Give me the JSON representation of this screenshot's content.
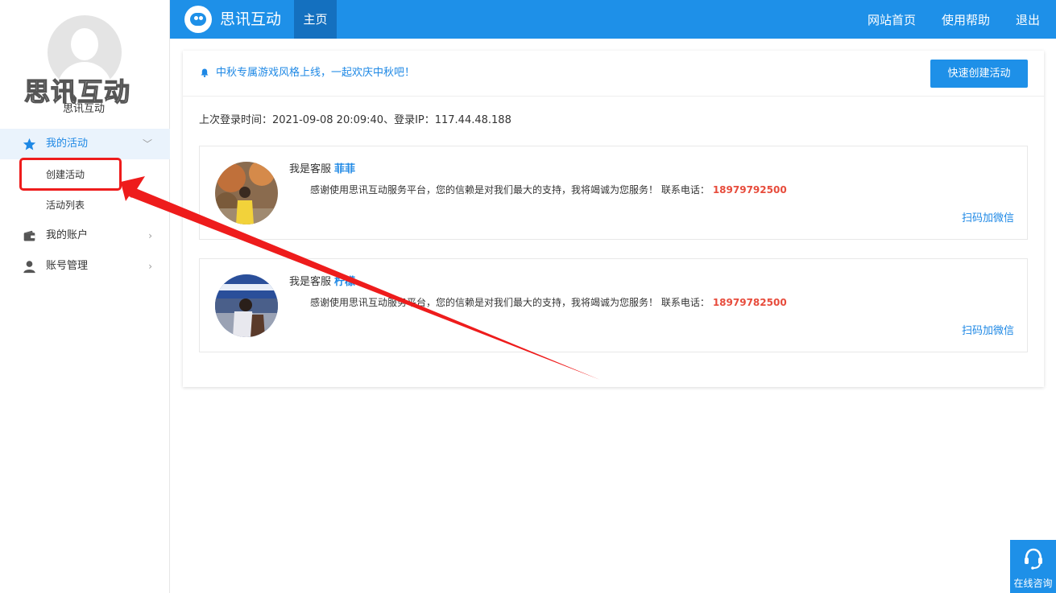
{
  "sidebar": {
    "brand_big": "思讯互动",
    "brand_small": "思讯互动",
    "menu": [
      {
        "label": "我的活动",
        "icon": "star-icon"
      },
      {
        "label": "我的账户",
        "icon": "wallet-icon"
      },
      {
        "label": "账号管理",
        "icon": "user-icon"
      }
    ],
    "submenu": [
      {
        "label": "创建活动"
      },
      {
        "label": "活动列表"
      }
    ]
  },
  "topbar": {
    "logo_title": "思讯互动",
    "home_tab": "主页",
    "links": [
      "网站首页",
      "使用帮助",
      "退出"
    ]
  },
  "main": {
    "notice": "中秋专属游戏风格上线，一起欢庆中秋吧！",
    "quick_create": "快速创建活动",
    "login_info": "上次登录时间：2021-09-08 20:09:40、登录IP：117.44.48.188",
    "service": [
      {
        "intro": "我是客服",
        "name": "菲菲",
        "message": "感谢使用思讯互动服务平台，您的信赖是对我们最大的支持，我将竭诚为您服务！ 联系电话：",
        "phone": "18979792500",
        "wechat": "扫码加微信"
      },
      {
        "intro": "我是客服",
        "name": "柠檬",
        "message": "感谢使用思讯互动服务平台，您的信赖是对我们最大的支持，我将竭诚为您服务！ 联系电话：",
        "phone": "18979782500",
        "wechat": "扫码加微信"
      }
    ]
  },
  "consult": {
    "label": "在线咨询"
  },
  "colors": {
    "primary": "#1e90e8",
    "active_bg": "#eaf3fc",
    "highlight": "#ee1c1c",
    "phone": "#e74c3c"
  }
}
